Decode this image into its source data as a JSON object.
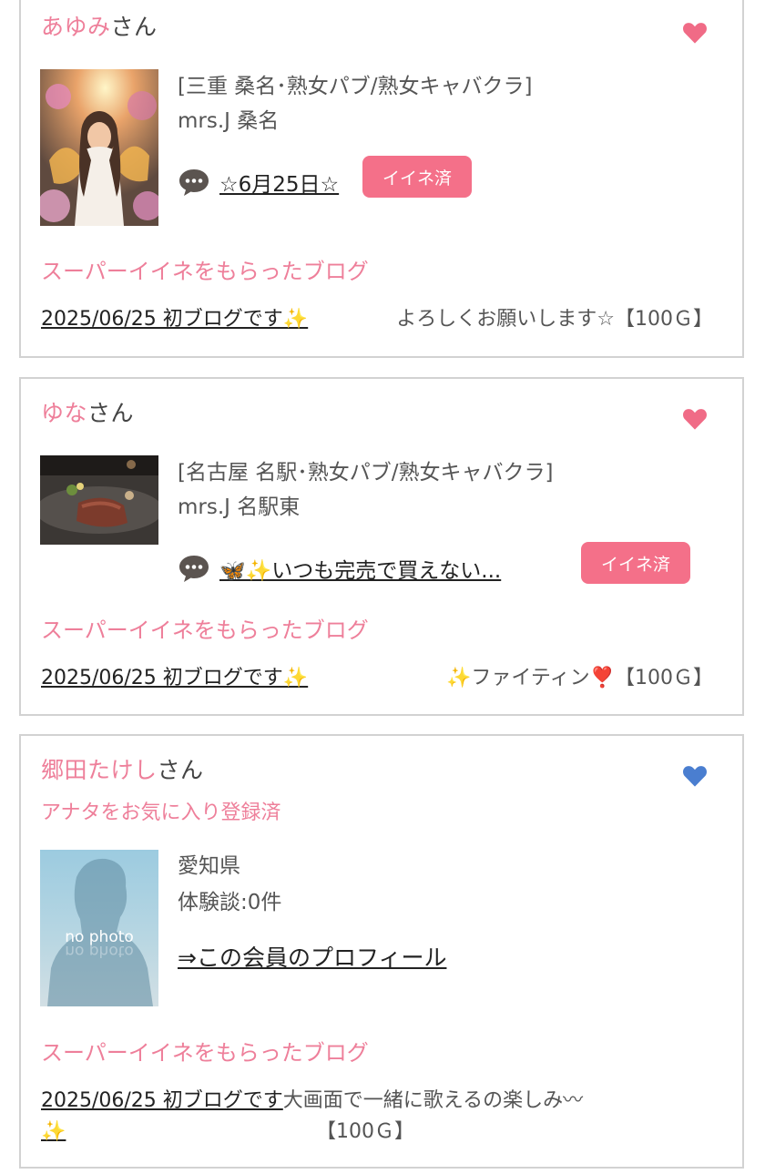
{
  "colors": {
    "accent": "#ee7f9a",
    "button": "#f47089",
    "heart_pink": "#f06b86",
    "heart_blue": "#4a7ed0"
  },
  "cards": [
    {
      "user_name": "あゆみ",
      "san": "さん",
      "heart_icon": "heart-pink-icon",
      "shop_category": "[三重 桑名･熟女パブ/熟女キャバクラ]",
      "shop_name": "mrs.J 桑名",
      "blog_title": "☆6月25日☆",
      "iine_label": "イイネ済",
      "section_title": "スーパーイイネをもらったブログ",
      "blog_date": "2025/06/25 初ブログです✨",
      "blog_message": "よろしくお願いします☆【100Ｇ】"
    },
    {
      "user_name": "ゆな",
      "san": "さん",
      "heart_icon": "heart-pink-icon",
      "shop_category": "[名古屋 名駅･熟女パブ/熟女キャバクラ]",
      "shop_name": "mrs.J 名駅東",
      "blog_title": "🦋✨いつも完売で買えない...",
      "iine_label": "イイネ済",
      "section_title": "スーパーイイネをもらったブログ",
      "blog_date": "2025/06/25 初ブログです✨",
      "blog_message": "✨ファイティン❣️【100Ｇ】"
    },
    {
      "user_name": "郷田たけし",
      "san": "さん",
      "heart_icon": "heart-blue-icon",
      "favorite_note": "アナタをお気に入り登録済",
      "prefecture": "愛知県",
      "reviews": "体験談:0件",
      "profile_link": "⇒この会員のプロフィール",
      "photo_placeholder": "no photo",
      "section_title": "スーパーイイネをもらったブログ",
      "blog_date": "2025/06/25 初ブログです",
      "blog_message": "大画面で一緒に歌えるの楽しみ〰",
      "blog_sparkle": "✨",
      "blog_price": "【100Ｇ】"
    }
  ]
}
